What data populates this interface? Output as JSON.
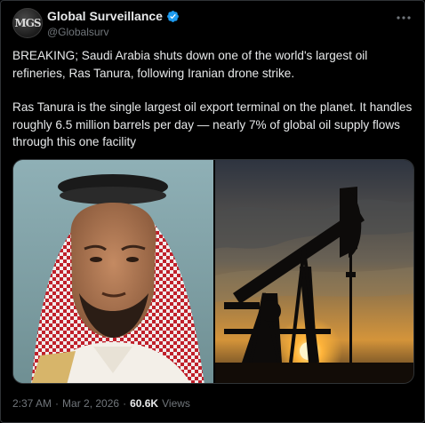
{
  "author": {
    "display_name": "Global Surveillance",
    "handle": "@Globalsurv",
    "avatar_text": "MGS",
    "verified": true
  },
  "tweet": {
    "paragraph_1": "BREAKING; Saudi Arabia shuts down one of the world's largest oil refineries, Ras Tanura, following Iranian drone strike.",
    "paragraph_2": "Ras Tanura is the single largest oil export terminal on the planet. It handles roughly 6.5 million barrels per day — nearly 7% of global oil supply flows through this one facility"
  },
  "media": {
    "left_image": "portrait-man-red-white-keffiyeh",
    "right_image": "oil-pumpjack-silhouette-sunset"
  },
  "meta": {
    "time": "2:37 AM",
    "separator": "·",
    "date": "Mar 2, 2026",
    "views_count": "60.6K",
    "views_label": "Views"
  },
  "colors": {
    "background": "#000000",
    "text": "#e7e9ea",
    "secondary": "#71767b",
    "border": "#2f3336",
    "verified": "#1d9bf0"
  },
  "icons": [
    "verified-badge-icon",
    "more-options-icon"
  ]
}
